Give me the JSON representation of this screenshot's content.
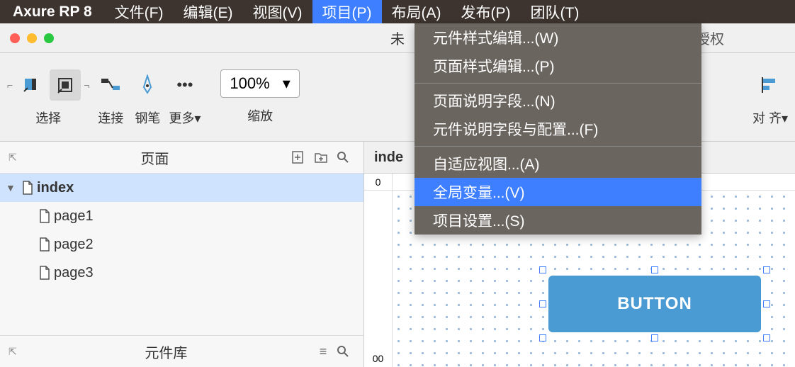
{
  "brand": "Axure RP 8",
  "menus": {
    "file": "文件(F)",
    "edit": "编辑(E)",
    "view": "视图(V)",
    "project": "项目(P)",
    "layout": "布局(A)",
    "publish": "发布(P)",
    "team": "团队(T)"
  },
  "titlebar": {
    "doc_prefix": "未",
    "license": "已授权"
  },
  "toolbar": {
    "select": "选择",
    "connect": "连接",
    "pen": "钢笔",
    "more": "更多",
    "zoom_value": "100%",
    "zoom_label": "缩放",
    "align": "对 齐"
  },
  "panels": {
    "pages_title": "页面",
    "library_title": "元件库"
  },
  "tree": [
    {
      "name": "index",
      "selected": true,
      "expanded": true
    },
    {
      "name": "page1",
      "child": true
    },
    {
      "name": "page2",
      "child": true
    },
    {
      "name": "page3",
      "child": true
    }
  ],
  "canvas": {
    "tab": "inde",
    "ruler_origin": "0",
    "ruler_bottom": "00",
    "button_label": "BUTTON"
  },
  "dropdown": {
    "widget_style": "元件样式编辑...(W)",
    "page_style": "页面样式编辑...(P)",
    "page_notes": "页面说明字段...(N)",
    "widget_notes": "元件说明字段与配置...(F)",
    "adaptive": "自适应视图...(A)",
    "global_vars": "全局变量...(V)",
    "project_settings": "项目设置...(S)"
  }
}
